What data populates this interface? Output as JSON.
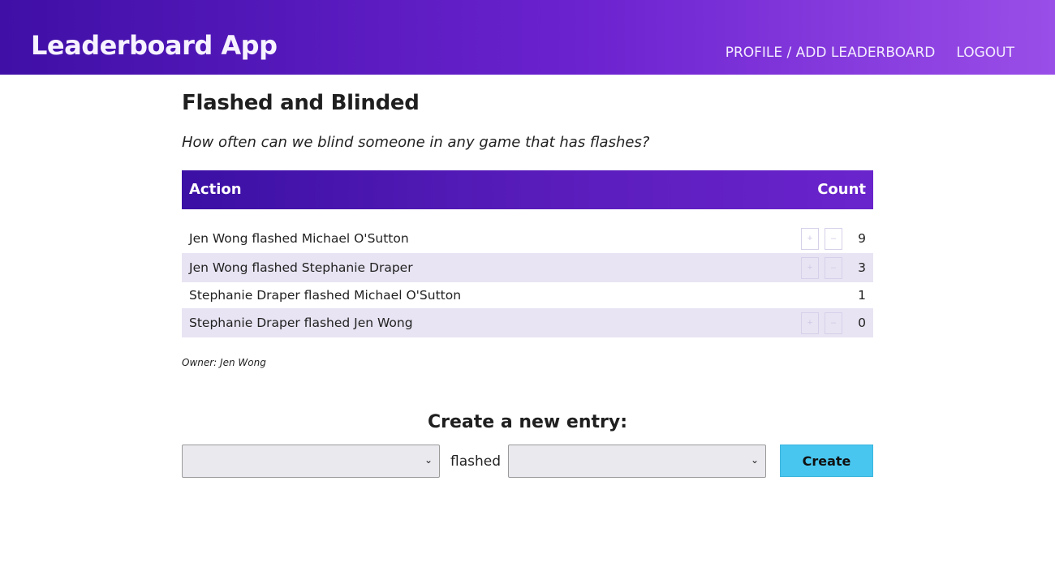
{
  "nav": {
    "brand": "Leaderboard App",
    "links": [
      "PROFILE / ADD LEADERBOARD",
      "LOGOUT"
    ]
  },
  "leaderboard": {
    "title": "Flashed and Blinded",
    "subtitle": "How often can we blind someone in any game that has flashes?",
    "columns": [
      "Action",
      "Count"
    ],
    "rows": [
      {
        "label": "Jen Wong flashed Michael O'Sutton",
        "count": "9",
        "plus": "+",
        "minus": "–"
      },
      {
        "label": "Jen Wong flashed Stephanie Draper",
        "count": "3",
        "plus": "+",
        "minus": "–"
      },
      {
        "label": "Stephanie Draper flashed Michael O'Sutton",
        "count": "1"
      },
      {
        "label": "Stephanie Draper flashed Jen Wong",
        "count": "0",
        "plus": "+",
        "minus": "–"
      }
    ],
    "owner": "Owner: Jen Wong"
  },
  "create": {
    "title": "Create a new entry:",
    "connector": "flashed",
    "button": "Create",
    "chevron": "⌄"
  }
}
